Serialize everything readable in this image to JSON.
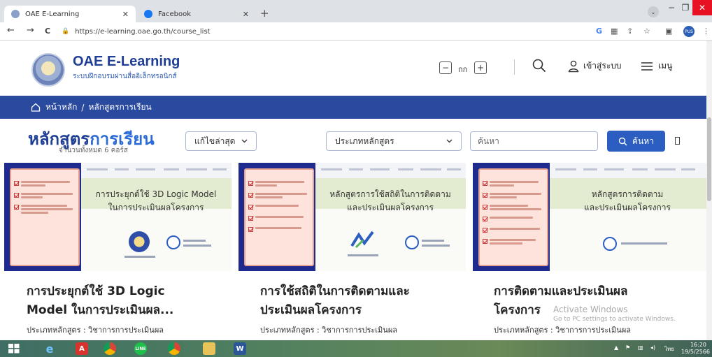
{
  "browser": {
    "tabs": [
      {
        "title": "OAE E-Learning",
        "close": "✕",
        "color": "#8aa0c8"
      },
      {
        "title": "Facebook",
        "close": "✕",
        "color": "#1877f2"
      }
    ],
    "new_tab": "+",
    "window": {
      "minimize": "−",
      "maximize": "❐",
      "close": "✕",
      "tab_menu": "⌄"
    },
    "nav": {
      "back": "←",
      "forward": "→",
      "reload": "C"
    },
    "url": "https://e-learning.oae.go.th/course_list",
    "toolbar_icons": {
      "g": "G",
      "translate": "▦",
      "share": "⇪",
      "bookmark": "☆",
      "sidepanel": "▣",
      "menu": "⋮"
    },
    "profile": "PUS"
  },
  "header": {
    "brand_title": "OAE E-Learning",
    "brand_subtitle": "ระบบฝึกอบรมผ่านสื่ออิเล็กทรอนิกส์",
    "font_minus": "−",
    "font_label": "กก",
    "font_plus": "+",
    "login_label": "เข้าสู่ระบบ",
    "menu_label": "เมนู"
  },
  "breadcrumb": {
    "home": "หน้าหลัก",
    "separator": "/",
    "current": "หลักสูตรการเรียน"
  },
  "filters": {
    "title_main": "หลักสูตร",
    "title_accent": "การเรียน",
    "count": "จำนวนทั้งหมด 6 คอร์ส",
    "sort_selected": "แก้ไขล่าสุด",
    "type_selected": "ประเภทหลักสูตร",
    "search_placeholder": "ค้นหา",
    "search_button": "ค้นหา"
  },
  "courses": [
    {
      "banner_line1": "การประยุกต์ใช้ 3D Logic Model",
      "banner_line2": "ในการประเมินผลโครงการ",
      "title_line1": "การประยุกต์ใช้ 3D Logic",
      "title_line2": "Model ในการประเมินผล...",
      "type": "ประเภทหลักสูตร : วิชาการการประเมินผล"
    },
    {
      "banner_line1": "หลักสูตรการใช้สถิติในการติดตาม",
      "banner_line2": "และประเมินผลโครงการ",
      "title_line1": "การใช้สถิติในการติดตามและ",
      "title_line2": "ประเมินผลโครงการ",
      "type": "ประเภทหลักสูตร : วิชาการการประเมินผล"
    },
    {
      "banner_line1": "หลักสูตรการติดตาม",
      "banner_line2": "และประเมินผลโครงการ",
      "title_line1": "การติดตามและประเมินผล",
      "title_line2": "โครงการ",
      "type": "ประเภทหลักสูตร : วิชาการการประเมินผล"
    }
  ],
  "watermark": {
    "line1": "Activate Windows",
    "line2": "Go to PC settings to activate Windows."
  },
  "taskbar": {
    "tray_lang": "ไทย",
    "time": "16:20",
    "date": "19/5/2566"
  },
  "colors": {
    "brand_blue": "#1f3f96",
    "breadcrumb_bg": "#2a4aa0",
    "search_button": "#2b5ec0"
  }
}
